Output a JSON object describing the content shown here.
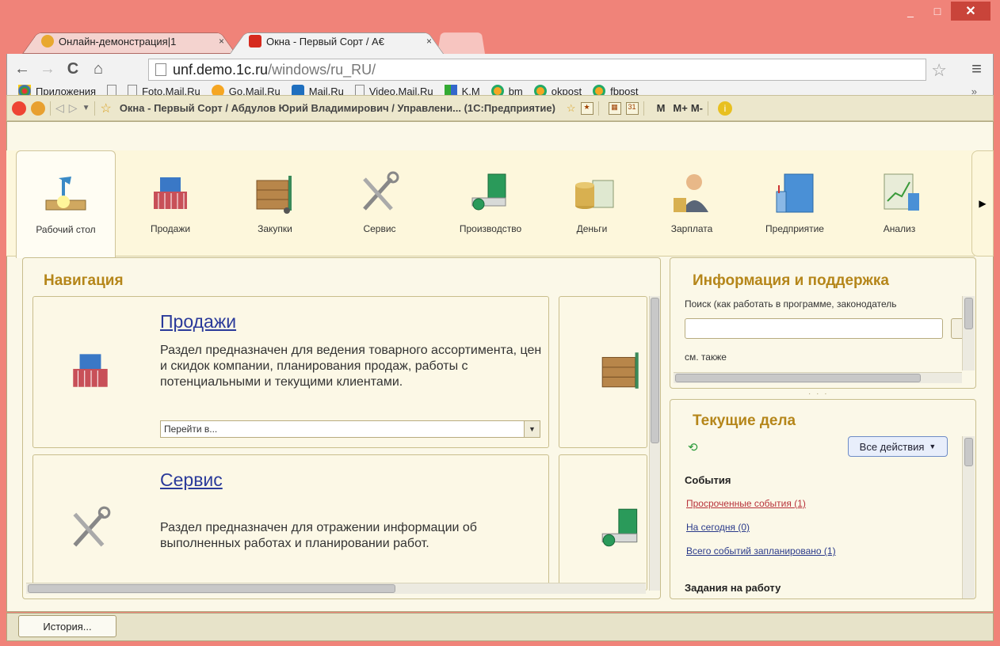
{
  "window": {
    "minimize": "_",
    "maximize": "□",
    "close": "✕"
  },
  "tabs": [
    {
      "title": "Онлайн-демонстрация|1",
      "close": "×",
      "favicon_color": "#e8a830"
    },
    {
      "title": "Окна - Первый Сорт / А€",
      "close": "×",
      "favicon_color": "#d62a1e"
    }
  ],
  "nav": {
    "back": "←",
    "forward": "→",
    "reload": "C",
    "home": "⌂"
  },
  "address": {
    "domain": "unf.demo.1c.ru",
    "path": "/windows/ru_RU/"
  },
  "bookmarks": [
    {
      "label": "Приложения",
      "icon": "apps-icon"
    },
    {
      "label": "",
      "icon": "page-icon"
    },
    {
      "label": "Foto.Mail.Ru",
      "icon": "page-icon"
    },
    {
      "label": "Go.Mail.Ru",
      "icon": "go-mail-icon"
    },
    {
      "label": "Mail.Ru",
      "icon": "mail-icon"
    },
    {
      "label": "Video.Mail.Ru",
      "icon": "page-icon"
    },
    {
      "label": "K.M",
      "icon": "km-icon"
    },
    {
      "label": "bm",
      "icon": "bm-icon"
    },
    {
      "label": "okpost",
      "icon": "bm-icon"
    },
    {
      "label": "fbpost",
      "icon": "bm-icon"
    }
  ],
  "bookmarks_more": "»",
  "app_header": {
    "title": "Окна - Первый Сорт / Абдулов Юрий Владимирович / Управлени...  (1С:Предприятие)",
    "calc_buttons": [
      "M",
      "M+",
      "M-"
    ]
  },
  "sections": [
    {
      "label": "Рабочий стол",
      "icon": "desktop-icon"
    },
    {
      "label": "Продажи",
      "icon": "sales-icon"
    },
    {
      "label": "Закупки",
      "icon": "purchases-icon"
    },
    {
      "label": "Сервис",
      "icon": "service-icon"
    },
    {
      "label": "Производство",
      "icon": "production-icon"
    },
    {
      "label": "Деньги",
      "icon": "money-icon"
    },
    {
      "label": "Зарплата",
      "icon": "salary-icon"
    },
    {
      "label": "Предприятие",
      "icon": "enterprise-icon"
    },
    {
      "label": "Анализ",
      "icon": "analysis-icon"
    }
  ],
  "navigation": {
    "title": "Навигация",
    "cards": [
      {
        "title": "Продажи",
        "description": "Раздел предназначен для ведения товарного ассортимента, цен и скидок компании, планирования продаж, работы с потенциальными и текущими клиентами.",
        "goto": "Перейти в..."
      },
      {
        "title": "Сервис",
        "description": "Раздел предназначен для отражении информации об выполненных работах и планировании работ."
      }
    ]
  },
  "info": {
    "title": "Информация и поддержка",
    "search_hint": "Поиск (как работать в программе, законодатель",
    "see_also": "см. также"
  },
  "tasks": {
    "title": "Текущие дела",
    "all_actions": "Все действия",
    "events_group": "События",
    "links": [
      {
        "label": "Просроченные события (1)",
        "color": "#b8323a"
      },
      {
        "label": "На сегодня (0)",
        "color": "#2a3a8a"
      },
      {
        "label": "Всего событий запланировано (1)",
        "color": "#2a3a8a"
      }
    ],
    "jobs_group": "Задания на работу"
  },
  "bottom": {
    "history": "История..."
  }
}
